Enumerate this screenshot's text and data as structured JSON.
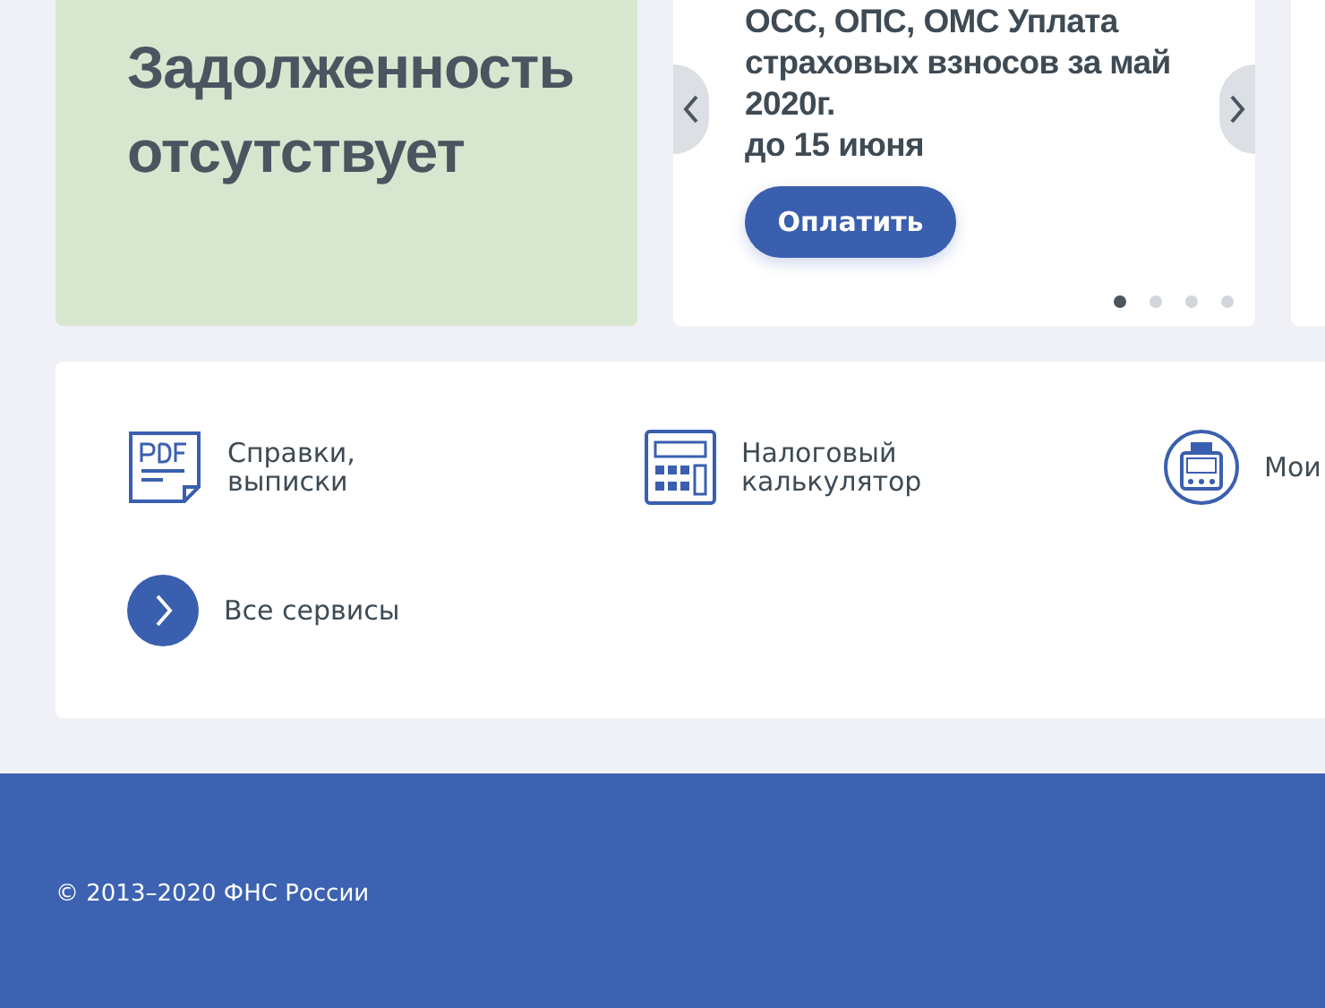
{
  "debt_card": {
    "text": "Задолженность отсутствует"
  },
  "payment_slider": {
    "title": "ОСС, ОПС, ОМС Уплата страховых взносов за май 2020г.",
    "deadline": "до 15 июня",
    "pay_button": "Оплатить",
    "dots": [
      {
        "selected": true
      },
      {
        "selected": false
      },
      {
        "selected": false
      },
      {
        "selected": false
      }
    ]
  },
  "services": [
    {
      "kind": "pdf",
      "label": "Справки, выписки"
    },
    {
      "kind": "calculator",
      "label": "Налоговый калькулятор"
    },
    {
      "kind": "cashbox",
      "label": "Мои"
    },
    {
      "kind": "all",
      "label": "Все сервисы"
    }
  ],
  "footer": {
    "copyright": "© 2013–2020 ФНС России"
  }
}
